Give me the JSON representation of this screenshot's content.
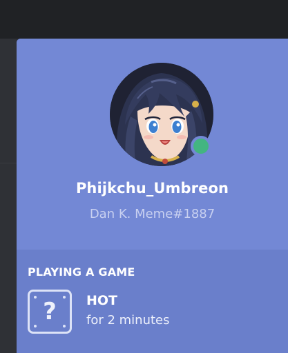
{
  "profile": {
    "username": "Phijkchu_Umbreon",
    "tag": "Dan K. Meme#1887",
    "status": "online",
    "status_color": "#43b581",
    "avatar": "anime-character-avatar"
  },
  "activity": {
    "section_title": "PLAYING A GAME",
    "game_name": "HOT",
    "elapsed": "for 2 minutes",
    "icon": "unknown-game-icon",
    "icon_glyph": "?"
  },
  "colors": {
    "header_bg": "#7388d5",
    "body_bg": "#6a7fcb",
    "accent": "#7289da"
  }
}
